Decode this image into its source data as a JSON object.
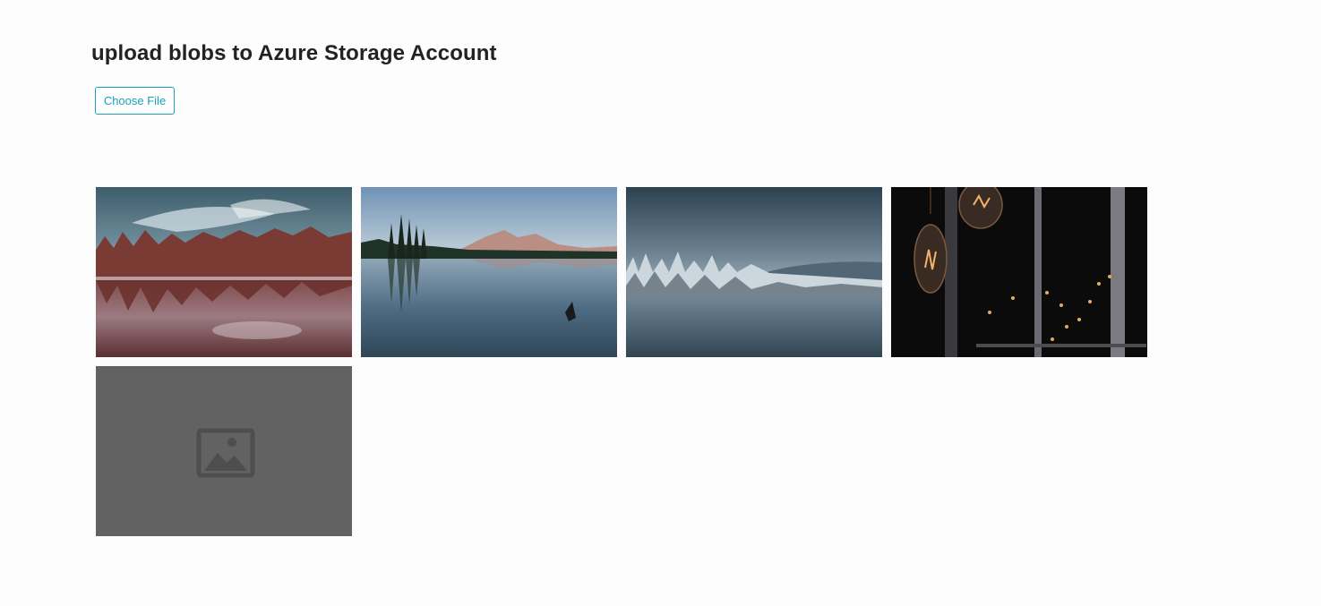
{
  "page": {
    "title": "upload blobs to Azure Storage Account"
  },
  "upload": {
    "button_label": "Choose File"
  },
  "gallery": {
    "images": [
      {
        "icon": "forest-lake-reflection-image"
      },
      {
        "icon": "mountain-lake-image"
      },
      {
        "icon": "snowy-lake-image"
      },
      {
        "icon": "light-bulbs-night-image"
      },
      {
        "icon": "image-placeholder-icon",
        "loaded": false
      }
    ]
  },
  "colors": {
    "accent": "#17a2b8",
    "placeholder_bg": "#626262",
    "page_bg": "#fdfdfd"
  }
}
